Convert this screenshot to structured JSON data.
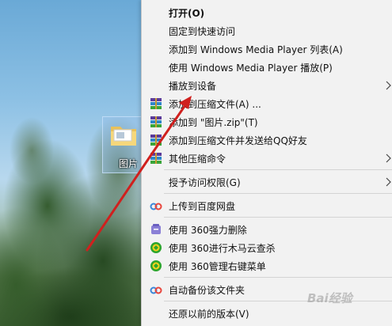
{
  "desktop": {
    "icon_label": "图片",
    "icon": "folder-icon"
  },
  "menu": {
    "items": [
      {
        "label": "打开(O)",
        "bold": true
      },
      {
        "label": "固定到快速访问"
      },
      {
        "label": "添加到 Windows Media Player 列表(A)"
      },
      {
        "label": "使用 Windows Media Player 播放(P)"
      },
      {
        "label": "播放到设备",
        "submenu": true
      },
      {
        "label": "添加到压缩文件(A) ...",
        "icon": "winrar-icon"
      },
      {
        "label": "添加到 \"图片.zip\"(T)",
        "icon": "winrar-icon"
      },
      {
        "label": "添加到压缩文件并发送给QQ好友",
        "icon": "winrar-icon"
      },
      {
        "label": "其他压缩命令",
        "icon": "winrar-icon",
        "submenu": true
      },
      {
        "label": "授予访问权限(G)",
        "submenu": true
      },
      {
        "label": "上传到百度网盘",
        "icon": "baidu-netdisk-icon"
      },
      {
        "label": "使用 360强力删除",
        "icon": "360-delete-icon"
      },
      {
        "label": "使用 360进行木马云查杀",
        "icon": "360-scan-icon"
      },
      {
        "label": "使用 360管理右键菜单",
        "icon": "360-manage-icon"
      },
      {
        "label": "自动备份该文件夹",
        "icon": "baidu-netdisk-icon"
      },
      {
        "label": "还原以前的版本(V)"
      }
    ]
  },
  "watermark": "Bai经验",
  "colors": {
    "menu_bg": "#f2f2f2",
    "separator": "#d4d4d4",
    "annotation_arrow": "#d0201e"
  }
}
